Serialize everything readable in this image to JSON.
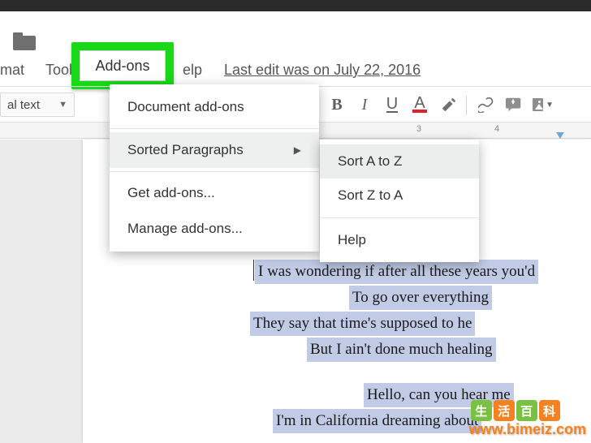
{
  "menubar": {
    "format_partial": "mat",
    "tools_partial": "Tools",
    "addons": "Add-ons",
    "help_partial": "elp",
    "last_edit": "Last edit was on July 22, 2016"
  },
  "toolbar": {
    "style_label_partial": "al text",
    "bold": "B",
    "italic": "I",
    "underline": "U",
    "textcolor": "A"
  },
  "ruler": {
    "labels": [
      "3",
      "4"
    ],
    "label_positions": [
      516,
      612
    ]
  },
  "addons_menu": {
    "items": [
      {
        "label": "Document add-ons",
        "has_submenu": false
      },
      {
        "label": "Sorted Paragraphs",
        "has_submenu": true,
        "active": true
      },
      {
        "label": "Get add-ons...",
        "has_submenu": false
      },
      {
        "label": "Manage add-ons...",
        "has_submenu": false
      }
    ],
    "separators_after": [
      0,
      1
    ]
  },
  "submenu": {
    "items": [
      {
        "label": "Sort A to Z",
        "highlight": true
      },
      {
        "label": "Sort Z to A",
        "highlight": false
      },
      {
        "label": "Help",
        "highlight": false
      }
    ],
    "separators_after": [
      1
    ]
  },
  "document": {
    "lines": [
      "I was wondering if after all these years you'd",
      "To go over everything",
      "They say that time's supposed to he",
      "But I ain't done much healing",
      "Hello, can you hear me",
      "I'm in California dreaming about"
    ]
  },
  "watermark": {
    "chars": [
      "生",
      "活",
      "百",
      "科"
    ],
    "url": "www.bimeiz.com"
  }
}
